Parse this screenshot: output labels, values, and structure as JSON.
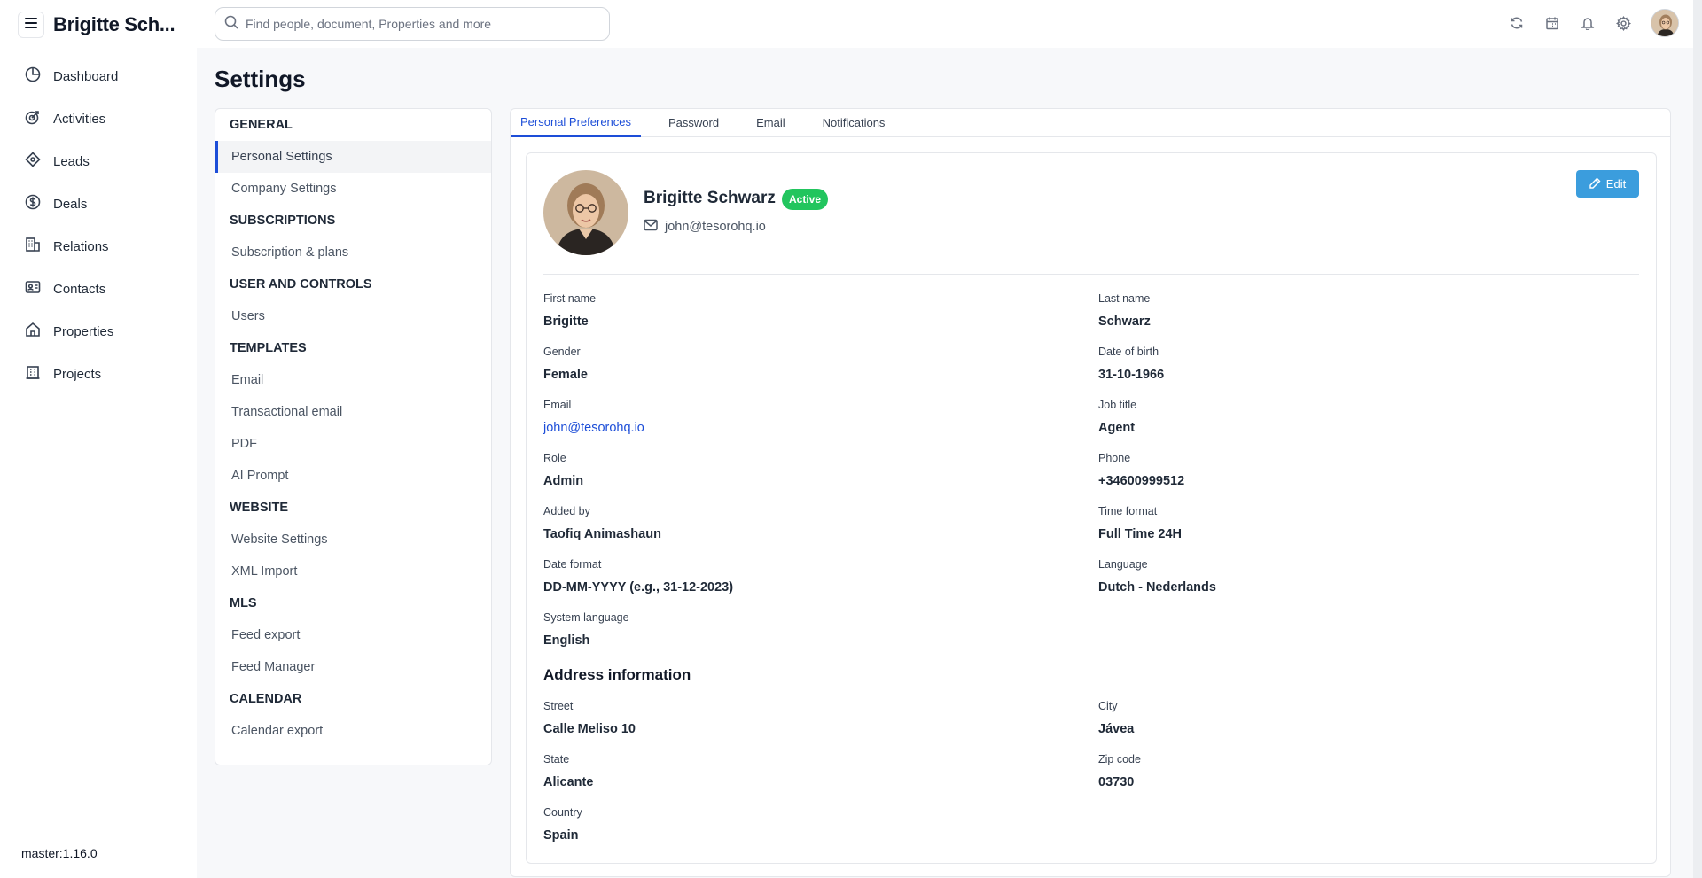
{
  "app": {
    "brand": "Brigitte Sch...",
    "version": "master:1.16.0"
  },
  "nav": {
    "items": [
      {
        "label": "Dashboard",
        "icon": "dashboard-icon"
      },
      {
        "label": "Activities",
        "icon": "activities-icon"
      },
      {
        "label": "Leads",
        "icon": "leads-icon"
      },
      {
        "label": "Deals",
        "icon": "deals-icon"
      },
      {
        "label": "Relations",
        "icon": "relations-icon"
      },
      {
        "label": "Contacts",
        "icon": "contacts-icon"
      },
      {
        "label": "Properties",
        "icon": "properties-icon"
      },
      {
        "label": "Projects",
        "icon": "projects-icon"
      }
    ]
  },
  "search": {
    "placeholder": "Find people, document, Properties and more"
  },
  "page": {
    "title": "Settings"
  },
  "settings_menu": [
    {
      "type": "head",
      "label": "GENERAL"
    },
    {
      "type": "item",
      "label": "Personal Settings",
      "active": true
    },
    {
      "type": "item",
      "label": "Company Settings"
    },
    {
      "type": "head",
      "label": "SUBSCRIPTIONS"
    },
    {
      "type": "item",
      "label": "Subscription & plans"
    },
    {
      "type": "head",
      "label": "USER AND CONTROLS"
    },
    {
      "type": "item",
      "label": "Users"
    },
    {
      "type": "head",
      "label": "TEMPLATES"
    },
    {
      "type": "item",
      "label": "Email"
    },
    {
      "type": "item",
      "label": "Transactional email"
    },
    {
      "type": "item",
      "label": "PDF"
    },
    {
      "type": "item",
      "label": "AI Prompt"
    },
    {
      "type": "head",
      "label": "WEBSITE"
    },
    {
      "type": "item",
      "label": "Website Settings"
    },
    {
      "type": "item",
      "label": "XML Import"
    },
    {
      "type": "head",
      "label": "MLS"
    },
    {
      "type": "item",
      "label": "Feed export"
    },
    {
      "type": "item",
      "label": "Feed Manager"
    },
    {
      "type": "head",
      "label": "CALENDAR"
    },
    {
      "type": "item",
      "label": "Calendar export"
    }
  ],
  "tabs": [
    {
      "label": "Personal Preferences",
      "active": true
    },
    {
      "label": "Password"
    },
    {
      "label": "Email"
    },
    {
      "label": "Notifications"
    }
  ],
  "profile": {
    "name": "Brigitte Schwarz",
    "status": "Active",
    "email": "john@tesorohq.io",
    "edit_label": "Edit"
  },
  "fields": {
    "first_name": {
      "label": "First name",
      "value": "Brigitte"
    },
    "last_name": {
      "label": "Last name",
      "value": "Schwarz"
    },
    "gender": {
      "label": "Gender",
      "value": "Female"
    },
    "dob": {
      "label": "Date of birth",
      "value": "31-10-1966"
    },
    "email": {
      "label": "Email",
      "value": "john@tesorohq.io"
    },
    "job_title": {
      "label": "Job title",
      "value": "Agent"
    },
    "role": {
      "label": "Role",
      "value": "Admin"
    },
    "phone": {
      "label": "Phone",
      "value": "+34600999512"
    },
    "added_by": {
      "label": "Added by",
      "value": "Taofiq Animashaun"
    },
    "time_format": {
      "label": "Time format",
      "value": "Full Time 24H"
    },
    "date_format": {
      "label": "Date format",
      "value": "DD-MM-YYYY (e.g., 31-12-2023)"
    },
    "language": {
      "label": "Language",
      "value": "Dutch - Nederlands"
    },
    "system_language": {
      "label": "System language",
      "value": "English"
    }
  },
  "address": {
    "title": "Address information",
    "street": {
      "label": "Street",
      "value": "Calle Meliso 10"
    },
    "city": {
      "label": "City",
      "value": "Jávea"
    },
    "state": {
      "label": "State",
      "value": "Alicante"
    },
    "zip": {
      "label": "Zip code",
      "value": "03730"
    },
    "country": {
      "label": "Country",
      "value": "Spain"
    }
  },
  "colors": {
    "accent": "#1d4ed8",
    "active_badge": "#22c55e",
    "edit_button": "#3b9ddd"
  }
}
